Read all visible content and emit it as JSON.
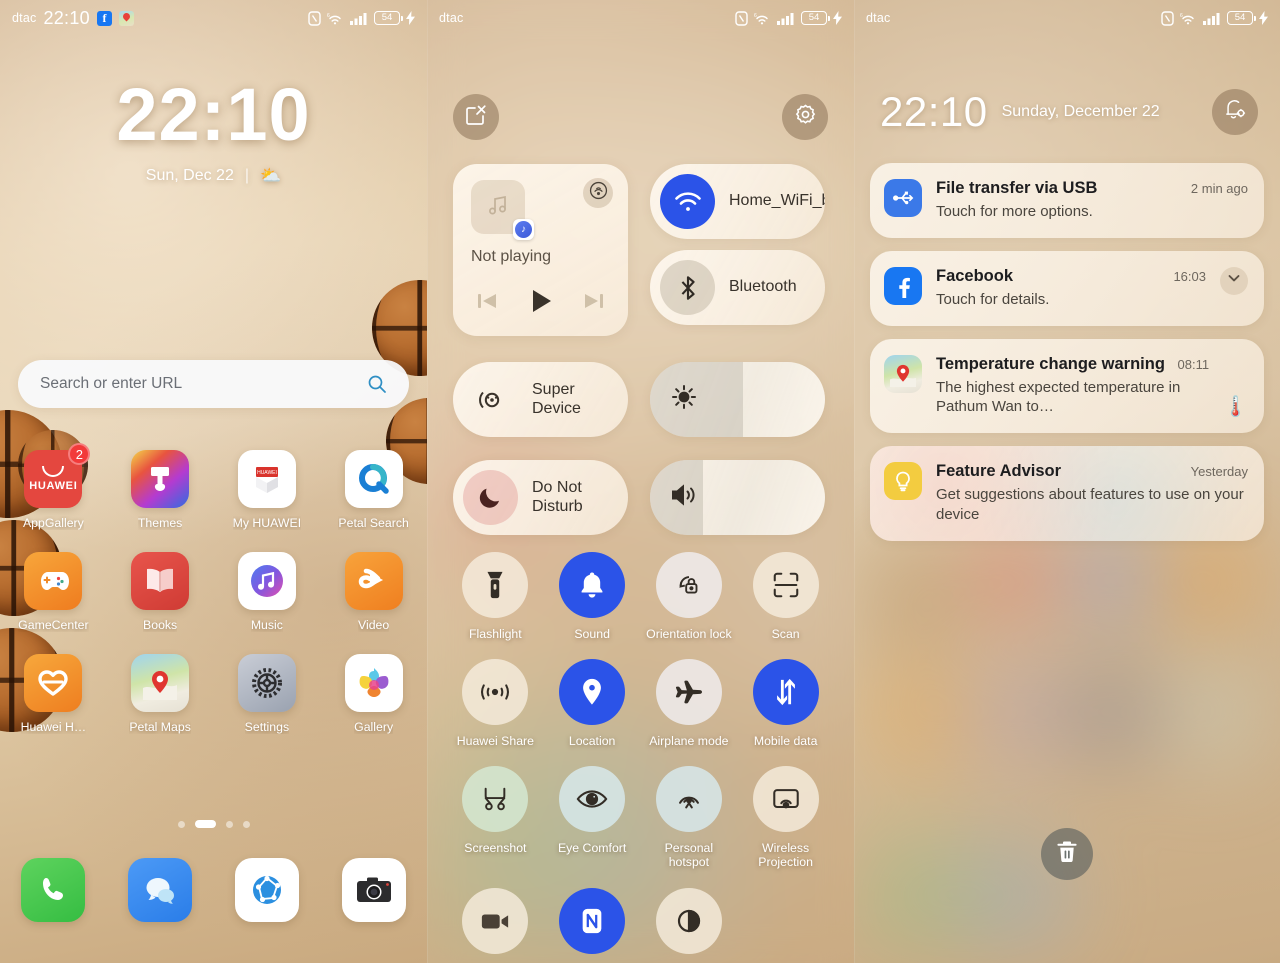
{
  "statusbar": {
    "carrier": "dtac",
    "time": "22:10",
    "battery": "54",
    "icons": [
      "nfc-icon",
      "wifi-icon",
      "signal-icon",
      "battery-icon",
      "charging-icon"
    ]
  },
  "home": {
    "clock": "22:10",
    "date": "Sun, Dec 22",
    "weather_glyph": "⛅",
    "search": {
      "placeholder": "Search or enter URL",
      "icon": "search-icon"
    },
    "apps": [
      {
        "label": "AppGallery",
        "icon": "appgallery-icon",
        "badge": "2"
      },
      {
        "label": "Themes",
        "icon": "themes-icon",
        "badge": ""
      },
      {
        "label": "My HUAWEI",
        "icon": "myhuawei-icon",
        "badge": ""
      },
      {
        "label": "Petal Search",
        "icon": "petalsearch-icon",
        "badge": ""
      },
      {
        "label": "GameCenter",
        "icon": "gamecenter-icon",
        "badge": ""
      },
      {
        "label": "Books",
        "icon": "books-icon",
        "badge": ""
      },
      {
        "label": "Music",
        "icon": "music-icon",
        "badge": ""
      },
      {
        "label": "Video",
        "icon": "video-icon",
        "badge": ""
      },
      {
        "label": "Huawei H…",
        "icon": "huaweihealth-icon",
        "badge": ""
      },
      {
        "label": "Petal Maps",
        "icon": "petalmaps-icon",
        "badge": ""
      },
      {
        "label": "Settings",
        "icon": "settings-icon",
        "badge": ""
      },
      {
        "label": "Gallery",
        "icon": "gallery-icon",
        "badge": ""
      }
    ],
    "page_dots": {
      "count": 4,
      "active_index": 1
    },
    "dock": [
      {
        "label": "Phone",
        "icon": "phone-icon"
      },
      {
        "label": "Messages",
        "icon": "messages-icon"
      },
      {
        "label": "Browser",
        "icon": "browser-icon"
      },
      {
        "label": "Camera",
        "icon": "camera-icon"
      }
    ]
  },
  "control_center": {
    "edit_button": "edit-icon",
    "settings_button": "gear-icon",
    "media": {
      "title": "Not playing",
      "cast_icon": "cast-icon",
      "app_badge_icon": "music-note-icon",
      "prev": "previous-track-icon",
      "play": "play-icon",
      "next": "next-track-icon"
    },
    "pills": [
      {
        "label": "Home_WiFi_bigg…",
        "icon": "wifi-icon",
        "state": "on"
      },
      {
        "label": "Bluetooth",
        "icon": "bluetooth-icon",
        "state": "off"
      },
      {
        "label": "Super Device",
        "icon": "superdevice-icon",
        "state": "plain"
      },
      {
        "label": "Do Not Disturb",
        "icon": "moon-icon",
        "state": "dnd"
      }
    ],
    "sliders": [
      {
        "name": "brightness",
        "icon": "brightness-icon",
        "percent": 53
      },
      {
        "name": "volume",
        "icon": "volume-icon",
        "percent": 30
      }
    ],
    "tiles": [
      {
        "label": "Flashlight",
        "icon": "flashlight-icon",
        "state": "off"
      },
      {
        "label": "Sound",
        "icon": "bell-icon",
        "state": "on"
      },
      {
        "label": "Orientation lock",
        "icon": "orientation-lock-icon",
        "state": "off-w"
      },
      {
        "label": "Scan",
        "icon": "scan-icon",
        "state": "off"
      },
      {
        "label": "Huawei Share",
        "icon": "huawei-share-icon",
        "state": "off"
      },
      {
        "label": "Location",
        "icon": "location-pin-icon",
        "state": "on"
      },
      {
        "label": "Airplane mode",
        "icon": "airplane-icon",
        "state": "off-w"
      },
      {
        "label": "Mobile data",
        "icon": "mobile-data-icon",
        "state": "on"
      },
      {
        "label": "Screenshot",
        "icon": "screenshot-icon",
        "state": "off-g"
      },
      {
        "label": "Eye Comfort",
        "icon": "eye-icon",
        "state": "off-b"
      },
      {
        "label": "Personal hotspot",
        "icon": "hotspot-icon",
        "state": "off-b"
      },
      {
        "label": "Wireless Projection",
        "icon": "wireless-projection-icon",
        "state": "off"
      },
      {
        "label": "",
        "icon": "screen-recorder-icon",
        "state": "off"
      },
      {
        "label": "",
        "icon": "nfc-icon",
        "state": "on"
      },
      {
        "label": "",
        "icon": "dark-mode-icon",
        "state": "off"
      }
    ]
  },
  "notifications": {
    "clock": "22:10",
    "date": "Sunday, December 22",
    "settings_button": "notification-settings-icon",
    "clear_button": "trash-icon",
    "items": [
      {
        "title": "File transfer via USB",
        "text": "Touch for more options.",
        "time": "2 min ago",
        "icon": "usb-icon",
        "expand": false,
        "emoji": ""
      },
      {
        "title": "Facebook",
        "text": "Touch for details.",
        "time": "16:03",
        "icon": "facebook-icon",
        "expand": true,
        "emoji": ""
      },
      {
        "title": "Temperature change warning",
        "text": "The highest expected temperature in Pathum Wan to…",
        "time": "08:11",
        "icon": "petalmaps-icon",
        "expand": false,
        "emoji": "🌡️"
      },
      {
        "title": "Feature Advisor",
        "text": "Get suggestions about features to use on your device",
        "time": "Yesterday",
        "icon": "lightbulb-icon",
        "expand": false,
        "emoji": ""
      }
    ]
  },
  "colors": {
    "accent_blue": "#2b53e8",
    "badge_red": "#f23a3a",
    "wallpaper_tan": "#dcc49f",
    "facebook_blue": "#1877F2"
  }
}
